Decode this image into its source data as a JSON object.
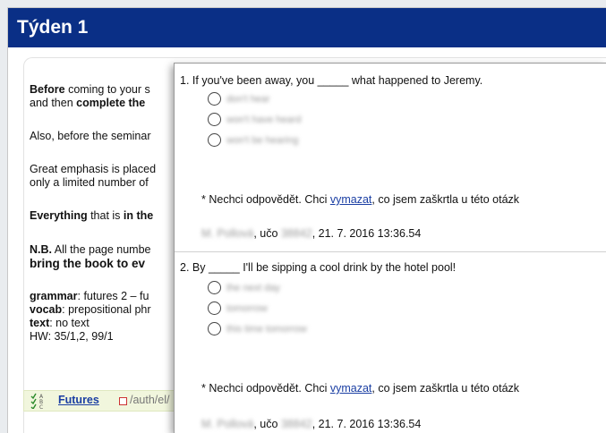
{
  "week": {
    "title": "Týden 1"
  },
  "content": {
    "p1a_bold": "Before",
    "p1a_rest": " coming to your s",
    "p1b_pre": "and then ",
    "p1b_bold": "complete the",
    "p2": "Also, before the seminar",
    "p3a": "Great emphasis is placed",
    "p3b": "only a limited number of",
    "p4_bold1": "Everything",
    "p4_mid": " that is ",
    "p4_bold2": "in the",
    "p5a_bold": "N.B.",
    "p5a_rest": " All the page numbe",
    "p5b_bold": "bring the book to ev",
    "l_grammar_key": "grammar",
    "l_grammar_val": ": futures 2 – fu",
    "l_vocab_key": "vocab",
    "l_vocab_val": ": prepositional phr",
    "l_text_key": "text",
    "l_text_val": ": no text",
    "l_hw": "HW: 35/1,2, 99/1"
  },
  "resource": {
    "link": "Futures",
    "path": "/auth/el/"
  },
  "quiz": {
    "q1": {
      "text": "1. If you've been away, you _____ what happened to Jeremy.",
      "options": [
        "don't hear",
        "won't have heard",
        "won't be hearing"
      ]
    },
    "q2": {
      "text": "2. By _____ I'll be sipping a cool drink by the hotel pool!",
      "options": [
        "the next day",
        "tomorrow",
        "this time tomorrow"
      ]
    },
    "clear_prefix": "* Nechci odpovědět. Chci ",
    "clear_link": "vymazat",
    "clear_suffix": ", co jsem zaškrtla u této otázk",
    "author_name": "M. Pollová",
    "uco_label": ", učo ",
    "uco_value": "38842",
    "timestamp": ", 21. 7. 2016 13:36.54"
  }
}
